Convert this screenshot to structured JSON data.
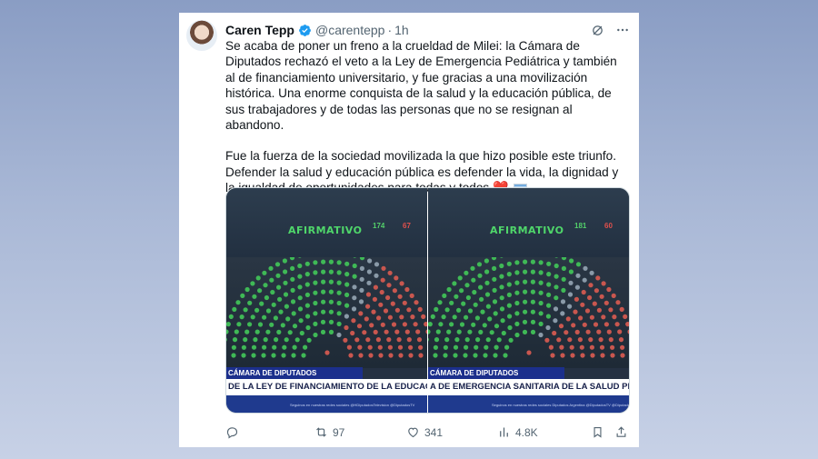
{
  "tweet": {
    "author_name": "Caren Tepp",
    "handle": "@carentepp",
    "separator": "·",
    "time": "1h",
    "paragraph1": "Se acaba de poner un freno a la crueldad de Milei: la Cámara de Diputados rechazó el veto a la Ley de Emergencia Pediátrica y también al de financiamiento universitario, y fue gracias a una movilización histórica. Una enorme conquista de la salud y la educación pública, de sus trabajadores y de todas las personas que no se resignan al abandono.",
    "paragraph2": "Fue la fuerza de la sociedad movilizada la que hizo posible este triunfo. Defender la salud y educación pública es defender la vida, la dignidad y la igualdad de oportunidades para todas y todos",
    "emoji_heart": "❤️",
    "icons": [
      "grok-icon",
      "more-icon"
    ]
  },
  "media": {
    "left": {
      "result": "AFIRMATIVO",
      "count_affirmative": "174",
      "count_negative": "67",
      "chamber": "CÁMARA DE DIPUTADOS",
      "ticker": "DE LA LEY DE FINANCIAMIENTO DE LA EDUCACIÓN UNIVER",
      "footer": "Seguinos en nuestras redes sociales   @HDiputadosTelevision   @DiputadosTV"
    },
    "right": {
      "result": "AFIRMATIVO",
      "count_affirmative": "181",
      "count_negative": "60",
      "chamber": "CÁMARA DE DIPUTADOS",
      "ticker": "A DE EMERGENCIA SANITARIA DE LA SALUD PEDIA",
      "footer": "Seguinos en nuestras redes sociales   Diputados Argentina   @DiputadosTV   @DiputadosTV"
    }
  },
  "actions": {
    "reply": "",
    "retweets": "97",
    "likes": "341",
    "views": "4.8K"
  },
  "colors": {
    "accent": "#1d9bf0",
    "affirmative": "#4fd66a",
    "negative": "#e0504c",
    "seat_blue": "#1b2f8c"
  }
}
